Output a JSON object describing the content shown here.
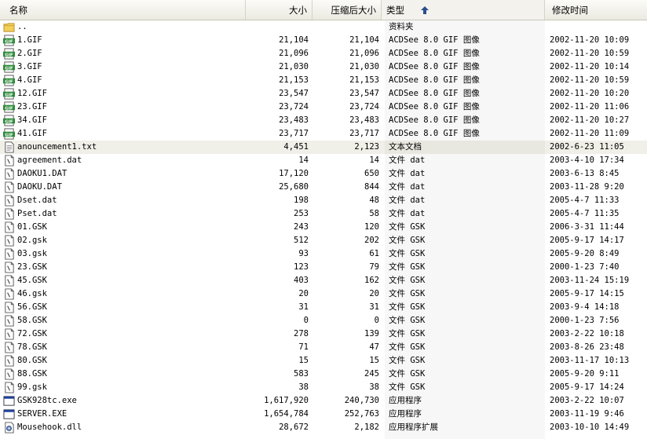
{
  "columns": {
    "name": "名称",
    "size": "大小",
    "compressed": "压缩后大小",
    "type": "类型",
    "modified": "修改时间"
  },
  "rows": [
    {
      "icon": "folder-up-icon",
      "name": "..",
      "size": "",
      "compressed": "",
      "type": "资料夹",
      "modified": ""
    },
    {
      "icon": "gif-file-icon",
      "name": "1.GIF",
      "size": "21,104",
      "compressed": "21,104",
      "type": "ACDSee 8.0 GIF 图像",
      "modified": "2002-11-20 10:09"
    },
    {
      "icon": "gif-file-icon",
      "name": "2.GIF",
      "size": "21,096",
      "compressed": "21,096",
      "type": "ACDSee 8.0 GIF 图像",
      "modified": "2002-11-20 10:59"
    },
    {
      "icon": "gif-file-icon",
      "name": "3.GIF",
      "size": "21,030",
      "compressed": "21,030",
      "type": "ACDSee 8.0 GIF 图像",
      "modified": "2002-11-20 10:14"
    },
    {
      "icon": "gif-file-icon",
      "name": "4.GIF",
      "size": "21,153",
      "compressed": "21,153",
      "type": "ACDSee 8.0 GIF 图像",
      "modified": "2002-11-20 10:59"
    },
    {
      "icon": "gif-file-icon",
      "name": "12.GIF",
      "size": "23,547",
      "compressed": "23,547",
      "type": "ACDSee 8.0 GIF 图像",
      "modified": "2002-11-20 10:20"
    },
    {
      "icon": "gif-file-icon",
      "name": "23.GIF",
      "size": "23,724",
      "compressed": "23,724",
      "type": "ACDSee 8.0 GIF 图像",
      "modified": "2002-11-20 11:06"
    },
    {
      "icon": "gif-file-icon",
      "name": "34.GIF",
      "size": "23,483",
      "compressed": "23,483",
      "type": "ACDSee 8.0 GIF 图像",
      "modified": "2002-11-20 10:27"
    },
    {
      "icon": "gif-file-icon",
      "name": "41.GIF",
      "size": "23,717",
      "compressed": "23,717",
      "type": "ACDSee 8.0 GIF 图像",
      "modified": "2002-11-20 11:09"
    },
    {
      "icon": "text-file-icon",
      "name": "anouncement1.txt",
      "size": "4,451",
      "compressed": "2,123",
      "type": "文本文档",
      "modified": "2002-6-23 11:05",
      "selected": true
    },
    {
      "icon": "generic-file-icon",
      "name": "agreement.dat",
      "size": "14",
      "compressed": "14",
      "type": "文件 dat",
      "modified": "2003-4-10 17:34"
    },
    {
      "icon": "generic-file-icon",
      "name": "DAOKU1.DAT",
      "size": "17,120",
      "compressed": "650",
      "type": "文件 dat",
      "modified": "2003-6-13 8:45"
    },
    {
      "icon": "generic-file-icon",
      "name": "DAOKU.DAT",
      "size": "25,680",
      "compressed": "844",
      "type": "文件 dat",
      "modified": "2003-11-28 9:20"
    },
    {
      "icon": "generic-file-icon",
      "name": "Dset.dat",
      "size": "198",
      "compressed": "48",
      "type": "文件 dat",
      "modified": "2005-4-7 11:33"
    },
    {
      "icon": "generic-file-icon",
      "name": "Pset.dat",
      "size": "253",
      "compressed": "58",
      "type": "文件 dat",
      "modified": "2005-4-7 11:35"
    },
    {
      "icon": "generic-file-icon",
      "name": "01.GSK",
      "size": "243",
      "compressed": "120",
      "type": "文件 GSK",
      "modified": "2006-3-31 11:44"
    },
    {
      "icon": "generic-file-icon",
      "name": "02.gsk",
      "size": "512",
      "compressed": "202",
      "type": "文件 GSK",
      "modified": "2005-9-17 14:17"
    },
    {
      "icon": "generic-file-icon",
      "name": "03.gsk",
      "size": "93",
      "compressed": "61",
      "type": "文件 GSK",
      "modified": "2005-9-20 8:49"
    },
    {
      "icon": "generic-file-icon",
      "name": "23.GSK",
      "size": "123",
      "compressed": "79",
      "type": "文件 GSK",
      "modified": "2000-1-23 7:40"
    },
    {
      "icon": "generic-file-icon",
      "name": "45.GSK",
      "size": "403",
      "compressed": "162",
      "type": "文件 GSK",
      "modified": "2003-11-24 15:19"
    },
    {
      "icon": "generic-file-icon",
      "name": "46.gsk",
      "size": "20",
      "compressed": "20",
      "type": "文件 GSK",
      "modified": "2005-9-17 14:15"
    },
    {
      "icon": "generic-file-icon",
      "name": "56.GSK",
      "size": "31",
      "compressed": "31",
      "type": "文件 GSK",
      "modified": "2003-9-4 14:18"
    },
    {
      "icon": "generic-file-icon",
      "name": "58.GSK",
      "size": "0",
      "compressed": "0",
      "type": "文件 GSK",
      "modified": "2000-1-23 7:56"
    },
    {
      "icon": "generic-file-icon",
      "name": "72.GSK",
      "size": "278",
      "compressed": "139",
      "type": "文件 GSK",
      "modified": "2003-2-22 10:18"
    },
    {
      "icon": "generic-file-icon",
      "name": "78.GSK",
      "size": "71",
      "compressed": "47",
      "type": "文件 GSK",
      "modified": "2003-8-26 23:48"
    },
    {
      "icon": "generic-file-icon",
      "name": "80.GSK",
      "size": "15",
      "compressed": "15",
      "type": "文件 GSK",
      "modified": "2003-11-17 10:13"
    },
    {
      "icon": "generic-file-icon",
      "name": "88.GSK",
      "size": "583",
      "compressed": "245",
      "type": "文件 GSK",
      "modified": "2005-9-20 9:11"
    },
    {
      "icon": "generic-file-icon",
      "name": "99.gsk",
      "size": "38",
      "compressed": "38",
      "type": "文件 GSK",
      "modified": "2005-9-17 14:24"
    },
    {
      "icon": "exe-file-icon",
      "name": "GSK928tc.exe",
      "size": "1,617,920",
      "compressed": "240,730",
      "type": "应用程序",
      "modified": "2003-2-22 10:07"
    },
    {
      "icon": "exe-file-icon",
      "name": "SERVER.EXE",
      "size": "1,654,784",
      "compressed": "252,763",
      "type": "应用程序",
      "modified": "2003-11-19 9:46"
    },
    {
      "icon": "dll-file-icon",
      "name": "Mousehook.dll",
      "size": "28,672",
      "compressed": "2,182",
      "type": "应用程序扩展",
      "modified": "2003-10-10 14:49"
    }
  ]
}
